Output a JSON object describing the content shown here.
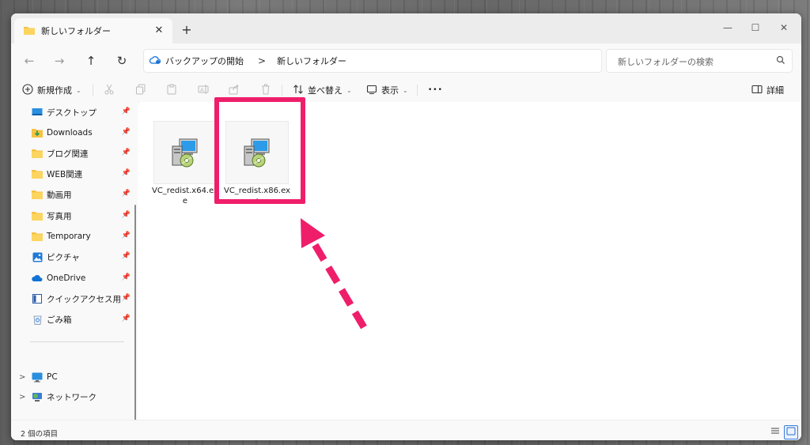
{
  "window": {
    "tab_title": "新しいフォルダー",
    "new_tab": "+",
    "close_tab": "✕",
    "minimize": "—",
    "maximize": "☐",
    "close": "✕"
  },
  "address": {
    "back": "←",
    "forward": "→",
    "up": "↑",
    "refresh": "↻",
    "breadcrumbs": [
      "バックアップの開始",
      "新しいフォルダー"
    ],
    "separator": ">",
    "search_placeholder": "新しいフォルダーの検索"
  },
  "toolbar": {
    "new_label": "新規作成",
    "sort_label": "並べ替え",
    "view_label": "表示",
    "more": "•••",
    "details_label": "詳細",
    "disabled_actions": [
      "scissors-icon",
      "copy-icon",
      "paste-icon",
      "rename-icon",
      "share-icon",
      "delete-icon"
    ]
  },
  "sidebar": {
    "items": [
      {
        "label": "デスクトップ",
        "icon": "desktop-icon",
        "pinned": true
      },
      {
        "label": "Downloads",
        "icon": "downloads-icon",
        "pinned": true
      },
      {
        "label": "ブログ関連",
        "icon": "folder-icon",
        "pinned": true
      },
      {
        "label": "WEB関連",
        "icon": "folder-icon",
        "pinned": true
      },
      {
        "label": "動画用",
        "icon": "folder-icon",
        "pinned": true
      },
      {
        "label": "写真用",
        "icon": "folder-icon",
        "pinned": true
      },
      {
        "label": "Temporary",
        "icon": "folder-icon",
        "pinned": true
      },
      {
        "label": "ピクチャ",
        "icon": "pictures-icon",
        "pinned": true
      },
      {
        "label": "OneDrive",
        "icon": "onedrive-icon",
        "pinned": true
      },
      {
        "label": "クイックアクセス用",
        "icon": "quickaccess-icon",
        "pinned": true
      },
      {
        "label": "ごみ箱",
        "icon": "recycle-bin-icon",
        "pinned": true
      }
    ],
    "tree": [
      {
        "label": "PC",
        "icon": "pc-icon",
        "expander": ">"
      },
      {
        "label": "ネットワーク",
        "icon": "network-icon",
        "expander": ">"
      }
    ],
    "pin_glyph": "📌"
  },
  "files": [
    {
      "name": "VC_redist.x64.exe",
      "icon": "installer-icon",
      "highlighted": false
    },
    {
      "name": "VC_redist.x86.exe",
      "icon": "installer-icon",
      "highlighted": true
    }
  ],
  "annotation": {
    "color": "#ef1e6b"
  },
  "status": {
    "item_count": "2 個の項目"
  }
}
